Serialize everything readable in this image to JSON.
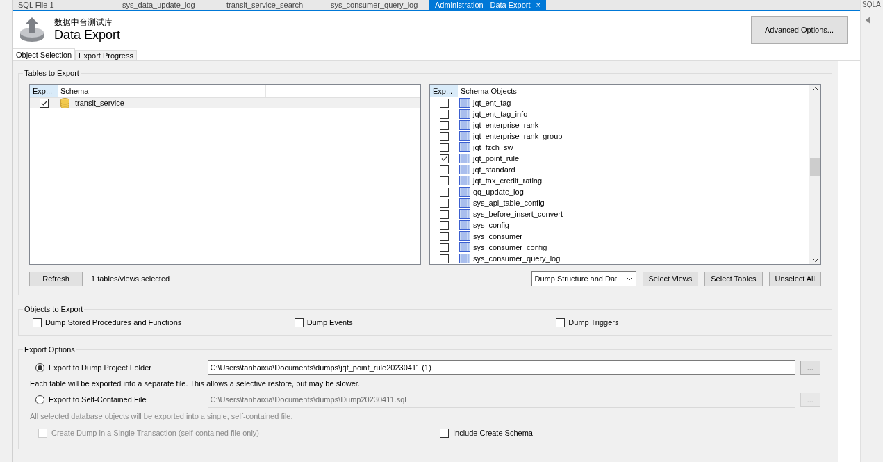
{
  "doc_tabs": [
    {
      "label": "SQL File 1",
      "selected": false
    },
    {
      "label": "sys_data_update_log",
      "selected": false
    },
    {
      "label": "transit_service_search",
      "selected": false
    },
    {
      "label": "sys_consumer_query_log",
      "selected": false
    },
    {
      "label": "Administration - Data Export",
      "selected": true,
      "close": "×"
    }
  ],
  "side_panel": {
    "title": "SQLA"
  },
  "header": {
    "subtitle": "数据中台测试库",
    "title": "Data Export",
    "advanced_button": "Advanced Options..."
  },
  "tabs": [
    {
      "label": "Object Selection",
      "selected": true
    },
    {
      "label": "Export Progress",
      "selected": false
    }
  ],
  "tables_to_export": {
    "title": "Tables to Export",
    "schema_list": {
      "columns": [
        "Exp...",
        "Schema"
      ],
      "rows": [
        {
          "name": "transit_service",
          "checked": true,
          "selected": true
        }
      ]
    },
    "objects_list": {
      "columns": [
        "Exp...",
        "Schema Objects"
      ],
      "rows": [
        {
          "name": "jqt_ent_tag",
          "checked": false
        },
        {
          "name": "jqt_ent_tag_info",
          "checked": false
        },
        {
          "name": "jqt_enterprise_rank",
          "checked": false
        },
        {
          "name": "jqt_enterprise_rank_group",
          "checked": false
        },
        {
          "name": "jqt_fzch_sw",
          "checked": false
        },
        {
          "name": "jqt_point_rule",
          "checked": true
        },
        {
          "name": "jqt_standard",
          "checked": false
        },
        {
          "name": "jqt_tax_credit_rating",
          "checked": false
        },
        {
          "name": "qq_update_log",
          "checked": false
        },
        {
          "name": "sys_api_table_config",
          "checked": false
        },
        {
          "name": "sys_before_insert_convert",
          "checked": false
        },
        {
          "name": "sys_config",
          "checked": false
        },
        {
          "name": "sys_consumer",
          "checked": false
        },
        {
          "name": "sys_consumer_config",
          "checked": false
        },
        {
          "name": "sys_consumer_query_log",
          "checked": false
        }
      ]
    },
    "refresh_button": "Refresh",
    "selection_count": "1 tables/views selected",
    "dump_mode": "Dump Structure and Dat",
    "buttons": [
      "Select Views",
      "Select Tables",
      "Unselect All"
    ]
  },
  "objects_to_export": {
    "title": "Objects to Export",
    "options": [
      {
        "label": "Dump Stored Procedures and Functions",
        "checked": false
      },
      {
        "label": "Dump Events",
        "checked": false
      },
      {
        "label": "Dump Triggers",
        "checked": false
      }
    ]
  },
  "export_options": {
    "title": "Export Options",
    "browse_button": "...",
    "destinations": [
      {
        "label": "Export to Dump Project Folder",
        "selected": true,
        "path": "C:\\Users\\tanhaixia\\Documents\\dumps\\jqt_point_rule20230411 (1)",
        "disabled": false,
        "note": "Each table will be exported into a separate file. This allows a selective restore, but may be slower."
      },
      {
        "label": "Export to Self-Contained File",
        "selected": false,
        "path": "C:\\Users\\tanhaixia\\Documents\\dumps\\Dump20230411.sql",
        "disabled": true,
        "note": "All selected database objects will be exported into a single, self-contained file."
      }
    ],
    "single_transaction": {
      "label": "Create Dump in a Single Transaction (self-contained file only)",
      "checked": false,
      "disabled": true
    },
    "include_schema": {
      "label": "Include Create Schema",
      "checked": false
    }
  }
}
